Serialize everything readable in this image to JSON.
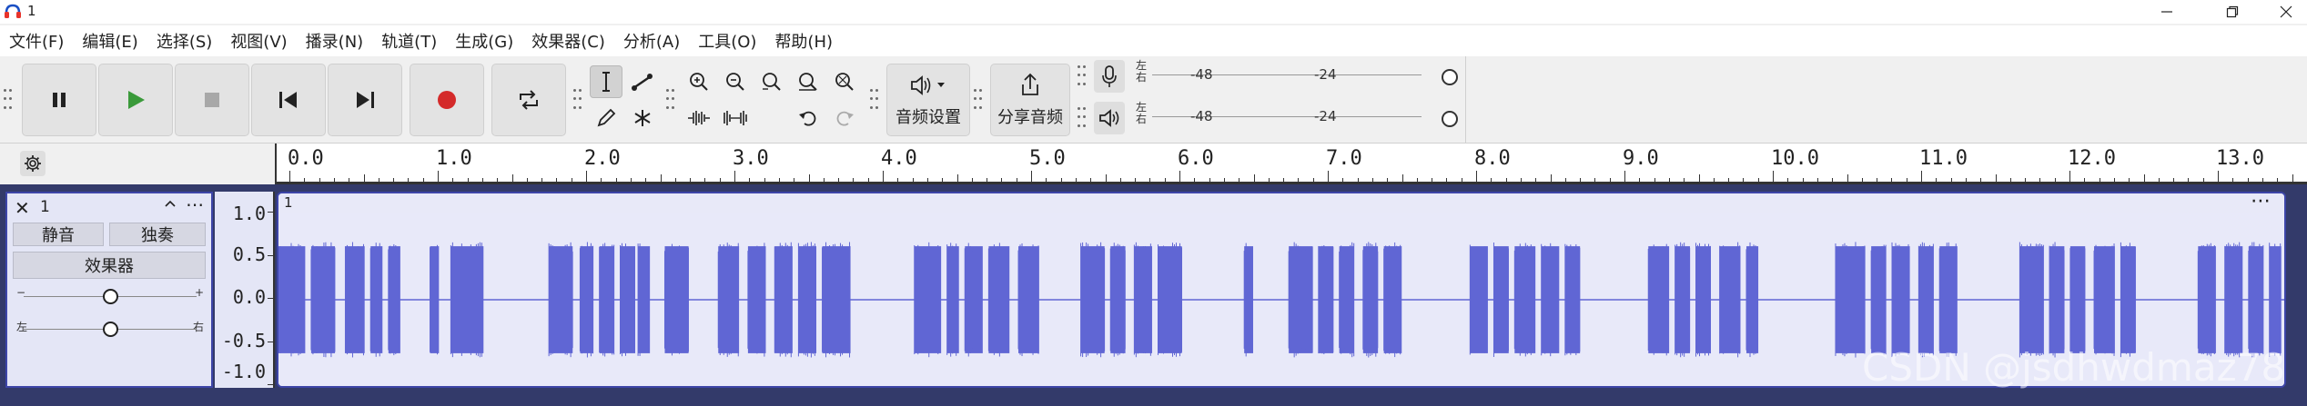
{
  "window": {
    "title": "1",
    "controls": {
      "minimize": "—",
      "maximize": "⧉",
      "close": "✕"
    }
  },
  "menu": [
    {
      "label": "文件(F)"
    },
    {
      "label": "编辑(E)"
    },
    {
      "label": "选择(S)"
    },
    {
      "label": "视图(V)"
    },
    {
      "label": "播录(N)"
    },
    {
      "label": "轨道(T)"
    },
    {
      "label": "生成(G)"
    },
    {
      "label": "效果器(C)"
    },
    {
      "label": "分析(A)"
    },
    {
      "label": "工具(O)"
    },
    {
      "label": "帮助(H)"
    }
  ],
  "toolbar": {
    "transport": [
      "pause",
      "play",
      "stop",
      "skip-to-start",
      "skip-to-end",
      "record",
      "loop"
    ],
    "audio_setup_label": "音频设置",
    "share_audio_label": "分享音频",
    "selected_tool": "selection-tool"
  },
  "meters": {
    "record": {
      "left_label": "左",
      "right_label": "右",
      "marks": [
        "-48",
        "-24"
      ]
    },
    "playback": {
      "left_label": "左",
      "right_label": "右",
      "marks": [
        "-48",
        "-24"
      ]
    }
  },
  "ruler": {
    "labels": [
      "0.0",
      "1.0",
      "2.0",
      "3.0",
      "4.0",
      "5.0",
      "6.0",
      "7.0",
      "8.0",
      "9.0",
      "10.0",
      "11.0",
      "12.0",
      "13.0"
    ]
  },
  "track": {
    "name": "1",
    "mute_label": "静音",
    "solo_label": "独奏",
    "effects_label": "效果器",
    "gain_minus": "−",
    "gain_plus": "+",
    "gain_value": 0.5,
    "pan_left": "左",
    "pan_right": "右",
    "pan_value": 0.5,
    "scale_labels": [
      "1.0",
      "0.5",
      "0.0",
      "-0.5",
      "-1.0"
    ],
    "clip_name": "1",
    "more": "⋯"
  },
  "colors": {
    "waveform": "#6066d4",
    "track_bg": "#333a6a",
    "accent": "#3d45a8"
  },
  "chart_data": {
    "type": "area",
    "title": "",
    "xlabel": "",
    "ylabel": "",
    "ylim": [
      -1.0,
      1.0
    ],
    "xlim": [
      0,
      13.5
    ],
    "bursts": [
      [
        0.0,
        0.18
      ],
      [
        0.22,
        0.38
      ],
      [
        0.45,
        0.58
      ],
      [
        0.62,
        0.7
      ],
      [
        0.74,
        0.82
      ],
      [
        1.02,
        1.08
      ],
      [
        1.16,
        1.38
      ],
      [
        1.82,
        1.98
      ],
      [
        2.03,
        2.12
      ],
      [
        2.16,
        2.26
      ],
      [
        2.3,
        2.4
      ],
      [
        2.42,
        2.5
      ],
      [
        2.6,
        2.76
      ],
      [
        2.96,
        3.1
      ],
      [
        3.16,
        3.28
      ],
      [
        3.34,
        3.46
      ],
      [
        3.5,
        3.62
      ],
      [
        3.66,
        3.85
      ],
      [
        4.28,
        4.46
      ],
      [
        4.5,
        4.58
      ],
      [
        4.62,
        4.74
      ],
      [
        4.78,
        4.92
      ],
      [
        4.98,
        5.12
      ],
      [
        5.4,
        5.56
      ],
      [
        5.6,
        5.7
      ],
      [
        5.76,
        5.88
      ],
      [
        5.92,
        6.08
      ],
      [
        6.5,
        6.56
      ],
      [
        6.8,
        6.96
      ],
      [
        7.0,
        7.1
      ],
      [
        7.14,
        7.24
      ],
      [
        7.3,
        7.4
      ],
      [
        7.44,
        7.56
      ],
      [
        8.02,
        8.14
      ],
      [
        8.18,
        8.28
      ],
      [
        8.32,
        8.46
      ],
      [
        8.5,
        8.62
      ],
      [
        8.66,
        8.76
      ],
      [
        9.22,
        9.36
      ],
      [
        9.4,
        9.5
      ],
      [
        9.54,
        9.64
      ],
      [
        9.7,
        9.84
      ],
      [
        9.88,
        9.96
      ],
      [
        10.48,
        10.68
      ],
      [
        10.72,
        10.82
      ],
      [
        10.86,
        10.98
      ],
      [
        11.04,
        11.14
      ],
      [
        11.18,
        11.3
      ],
      [
        11.72,
        11.88
      ],
      [
        11.92,
        12.02
      ],
      [
        12.06,
        12.16
      ],
      [
        12.22,
        12.36
      ],
      [
        12.4,
        12.5
      ],
      [
        12.92,
        13.04
      ],
      [
        13.1,
        13.22
      ],
      [
        13.26,
        13.36
      ],
      [
        13.4,
        13.48
      ]
    ],
    "burst_amplitude": 0.62,
    "silence_amplitude": 0.01
  },
  "watermark": "CSDN @jsdhwdmaz78"
}
